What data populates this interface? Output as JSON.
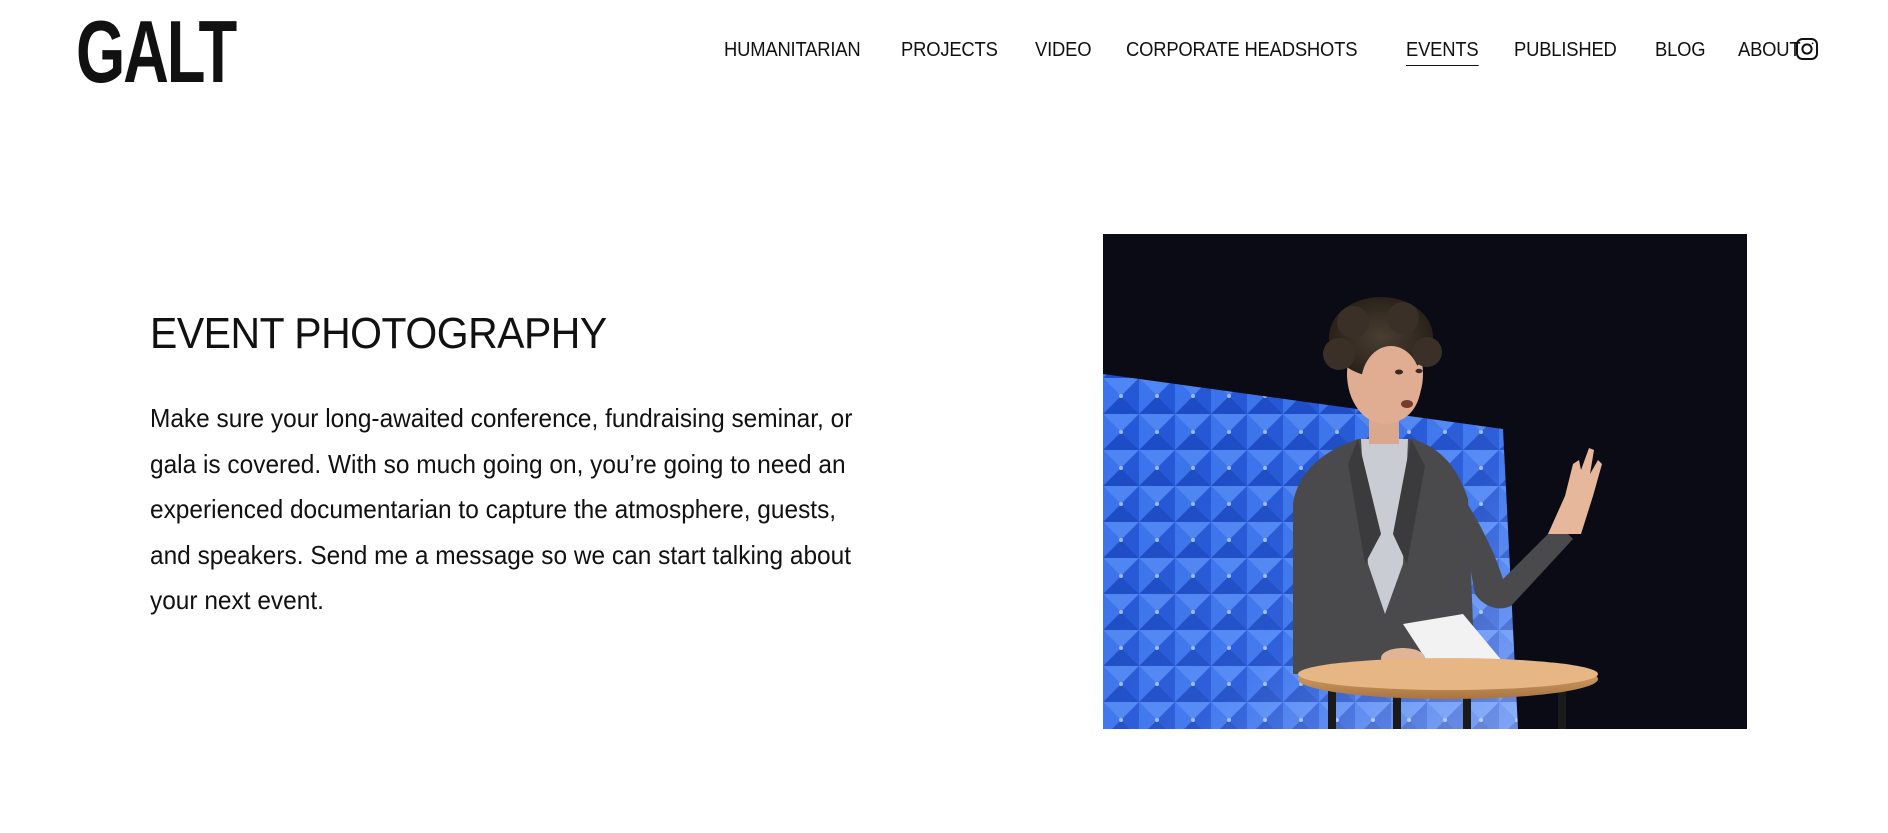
{
  "brand": {
    "logo_text": "GALT"
  },
  "nav": {
    "items": [
      {
        "label": "HUMANITARIAN"
      },
      {
        "label": "PROJECTS"
      },
      {
        "label": "VIDEO"
      },
      {
        "label": "CORPORATE HEADSHOTS"
      },
      {
        "label": "EVENTS",
        "active": true
      },
      {
        "label": "PUBLISHED"
      },
      {
        "label": "BLOG"
      },
      {
        "label": "ABOUT"
      }
    ],
    "social_icon": "instagram-icon"
  },
  "main": {
    "heading": "EVENT PHOTOGRAPHY",
    "body": "Make sure your long-awaited conference, fundraising seminar, or gala is covered. With so much going on, you’re going to need an experienced documentarian to capture the atmosphere, guests, and speakers. Send me a message so we can start talking about your next event.",
    "image_subject": "speaker-on-stage-photo"
  },
  "colors": {
    "text": "#111111",
    "background": "#ffffff",
    "photo_backdrop": "#0a0b15",
    "stage_panel_blue": "#2f6cf0",
    "podium_wood": "#c8955e"
  }
}
